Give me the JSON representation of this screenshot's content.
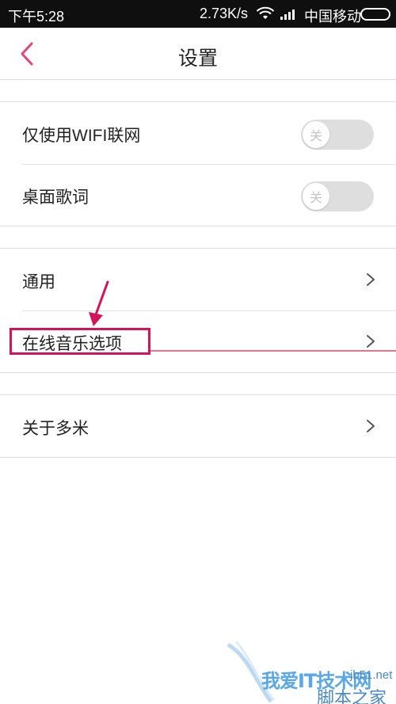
{
  "status_bar": {
    "time": "下午5:28",
    "speed": "2.73K/s",
    "carrier": "中国移动",
    "icons": [
      "wifi-icon",
      "signal-icon",
      "battery-icon"
    ]
  },
  "header": {
    "title": "设置",
    "back_icon": "chevron-left-icon"
  },
  "sections": [
    {
      "rows": [
        {
          "label": "仅使用WIFI联网",
          "control": "toggle",
          "toggle_text": "关",
          "state": "off"
        },
        {
          "label": "桌面歌词",
          "control": "toggle",
          "toggle_text": "关",
          "state": "off"
        }
      ]
    },
    {
      "rows": [
        {
          "label": "通用",
          "control": "chevron"
        },
        {
          "label": "在线音乐选项",
          "control": "chevron"
        }
      ]
    },
    {
      "rows": [
        {
          "label": "关于多米",
          "control": "chevron"
        }
      ]
    }
  ],
  "annotation": {
    "highlight_color": "#d4145a",
    "arrow_color": "#d4145a"
  },
  "watermark": {
    "text_main": "我爱IT技术网",
    "text_url": "jb51.net",
    "text_site": "脚本之家"
  },
  "colors": {
    "accent": "#e0457b",
    "toggle_off_bg": "#dedede",
    "divider": "#e3e3e3",
    "status_bar_bg": "#0f0f0f"
  }
}
